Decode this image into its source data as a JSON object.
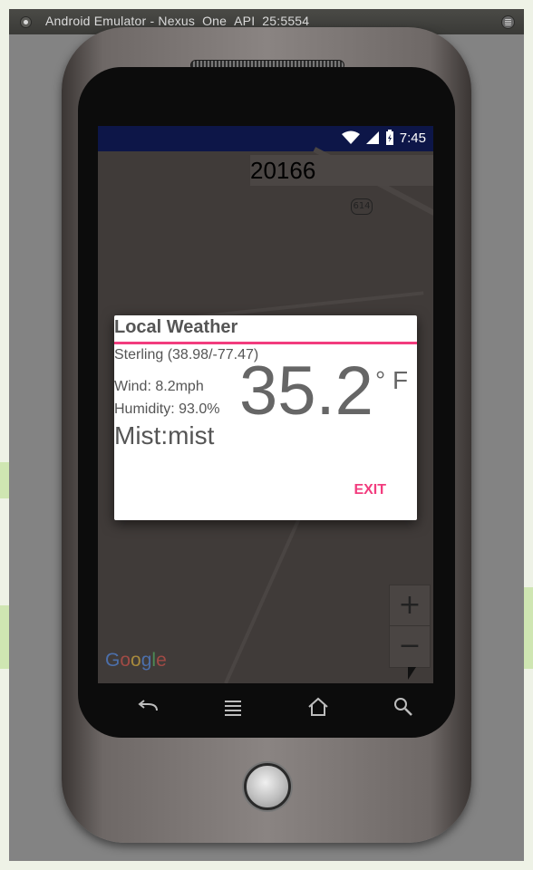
{
  "window": {
    "title": "Android Emulator - Nexus_One_API_25:5554"
  },
  "status_bar": {
    "time": "7:45",
    "icons": [
      "wifi-icon",
      "signal-icon",
      "battery-icon"
    ]
  },
  "map": {
    "zip_code": "20166",
    "route_label": "614",
    "zoom_in": "+",
    "zoom_out": "−",
    "attribution": [
      "G",
      "o",
      "o",
      "g",
      "l",
      "e"
    ]
  },
  "dialog": {
    "title": "Local Weather",
    "location": "Sterling (38.98/-77.47)",
    "wind": "Wind: 8.2mph",
    "humidity": "Humidity: 93.0%",
    "condition": "Mist:mist",
    "temperature": "35.2",
    "unit": "° F",
    "exit_label": "EXIT"
  },
  "nav_bar": {
    "icons": [
      "back-icon",
      "menu-icon",
      "home-icon",
      "search-icon"
    ]
  },
  "colors": {
    "accent": "#f23c7e",
    "status_bar": "#0d1648",
    "text": "#555555"
  }
}
